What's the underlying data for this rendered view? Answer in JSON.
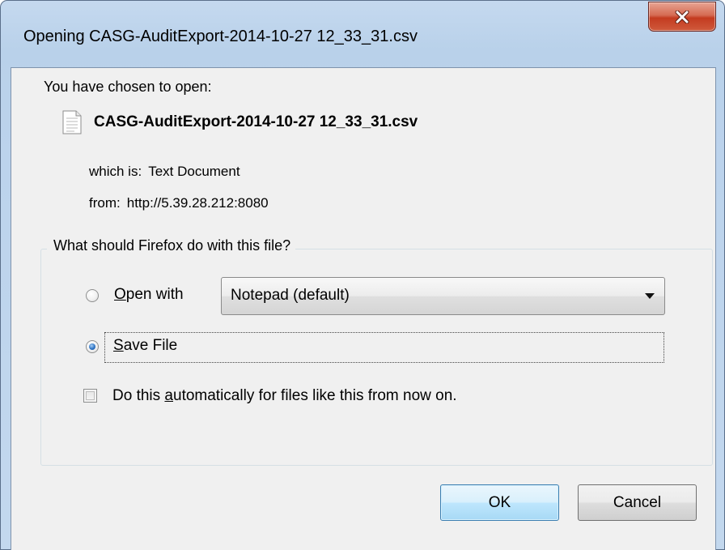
{
  "window": {
    "title": "Opening CASG-AuditExport-2014-10-27 12_33_31.csv",
    "close_icon": "close-icon"
  },
  "dialog": {
    "intro": "You have chosen to open:",
    "file_icon": "text-document-icon",
    "file_name": "CASG-AuditExport-2014-10-27 12_33_31.csv",
    "which_is_label": "which is:",
    "which_is_value": "Text Document",
    "from_label": "from:",
    "from_value": "http://5.39.28.212:8080",
    "question": "What should Firefox do with this file?",
    "open_with": {
      "label_accel": "O",
      "label_rest": "pen with",
      "selected": false,
      "app_selected": "Notepad (default)"
    },
    "save_file": {
      "label_accel": "S",
      "label_rest": "ave File",
      "selected": true
    },
    "auto": {
      "label_pre": "Do this ",
      "label_accel": "a",
      "label_post": "utomatically for files like this from now on.",
      "checked": false
    },
    "buttons": {
      "ok": "OK",
      "cancel": "Cancel"
    }
  }
}
